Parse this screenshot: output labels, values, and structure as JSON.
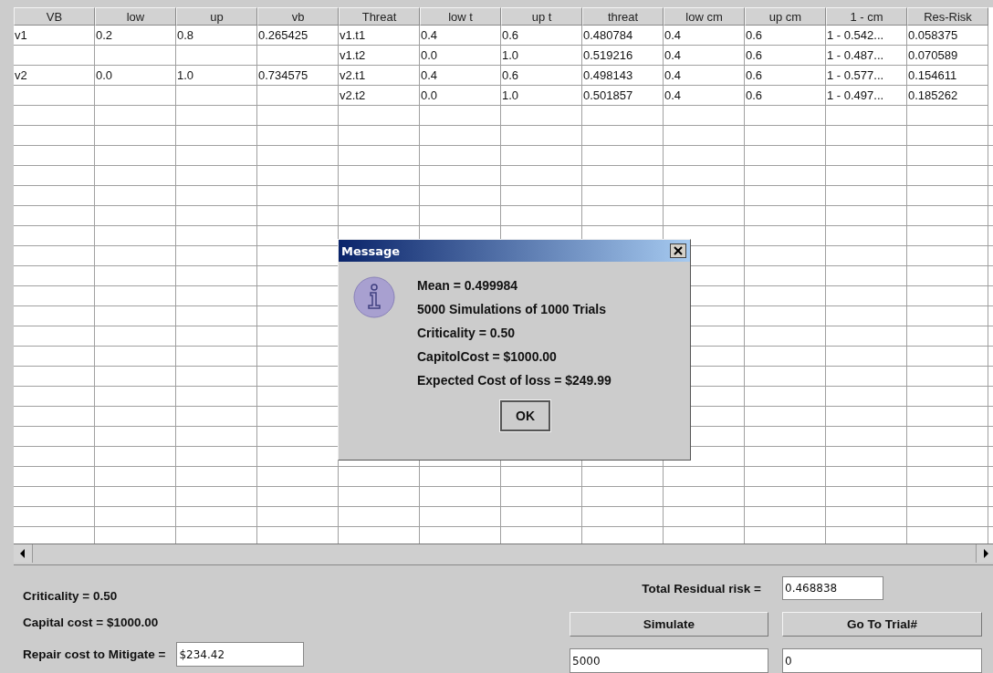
{
  "table": {
    "columns": [
      "VB",
      "low",
      "up",
      "vb",
      "Threat",
      "low t",
      "up t",
      "threat",
      "low cm",
      "up cm",
      "1 - cm",
      "Res-Risk"
    ],
    "rows": [
      [
        "v1",
        "0.2",
        "0.8",
        "0.265425",
        "v1.t1",
        "0.4",
        "0.6",
        "0.480784",
        "0.4",
        "0.6",
        "1 - 0.542...",
        "0.058375"
      ],
      [
        "",
        "",
        "",
        "",
        "v1.t2",
        "0.0",
        "1.0",
        "0.519216",
        "0.4",
        "0.6",
        "1 - 0.487...",
        "0.070589"
      ],
      [
        "v2",
        "0.0",
        "1.0",
        "0.734575",
        "v2.t1",
        "0.4",
        "0.6",
        "0.498143",
        "0.4",
        "0.6",
        "1 - 0.577...",
        "0.154611"
      ],
      [
        "",
        "",
        "",
        "",
        "v2.t2",
        "0.0",
        "1.0",
        "0.501857",
        "0.4",
        "0.6",
        "1 - 0.497...",
        "0.185262"
      ]
    ]
  },
  "dialog": {
    "title": "Message",
    "lines": [
      "Mean = 0.499984",
      "5000 Simulations  of 1000 Trials",
      "Criticality = 0.50",
      "CapitolCost = $1000.00",
      "Expected Cost of loss = $249.99"
    ],
    "button": "OK"
  },
  "summary": {
    "criticality": "Criticality  =  0.50",
    "capital_cost": "Capital cost  =  $1000.00",
    "repair_label": "Repair cost to Mitigate  =",
    "repair_value": "$234.42",
    "residual_label": "Total Residual risk =",
    "residual_value": "0.468838"
  },
  "buttons": [
    "Simulate",
    "Go To Trial#"
  ],
  "inputs": [
    "5000",
    "0"
  ]
}
